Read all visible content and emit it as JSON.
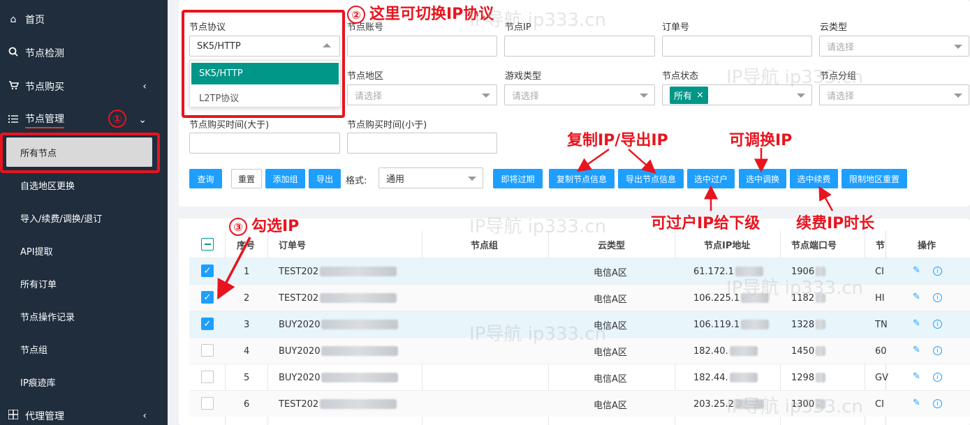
{
  "sidebar": {
    "items": [
      {
        "label": "首页",
        "icon": "home-icon"
      },
      {
        "label": "节点检测",
        "icon": "search-icon"
      },
      {
        "label": "节点购买",
        "icon": "cart-icon"
      },
      {
        "label": "节点管理",
        "icon": "list-icon"
      },
      {
        "label": "代理管理",
        "icon": "grid-icon"
      }
    ],
    "sub_items": [
      "所有节点",
      "自选地区更换",
      "导入/续费/调换/退订",
      "API提取",
      "所有订单",
      "节点操作记录",
      "节点组",
      "IP痕迹库"
    ]
  },
  "filters": {
    "protocol_label": "节点协议",
    "protocol_value": "SK5/HTTP",
    "protocol_options": [
      "SK5/HTTP",
      "L2TP协议"
    ],
    "account_label": "节点账号",
    "ip_label": "节点IP",
    "order_label": "订单号",
    "cloud_label": "云类型",
    "cloud_placeholder": "请选择",
    "region_label": "节点地区",
    "region_placeholder": "请选择",
    "game_label": "游戏类型",
    "game_placeholder": "请选择",
    "status_label": "节点状态",
    "status_tag": "所有",
    "group_label": "节点分组",
    "group_placeholder": "请选择",
    "buy_after_label": "节点购买时间(大于)",
    "buy_before_label": "节点购买时间(小于)",
    "format_label": "格式:",
    "format_value": "通用"
  },
  "buttons": {
    "query": "查询",
    "reset": "重置",
    "add_group": "添加组",
    "export": "导出",
    "expiring": "即将过期",
    "copy_info": "复制节点信息",
    "export_info": "导出节点信息",
    "transfer": "选中过户",
    "swap": "选中调换",
    "renew": "选中续费",
    "reset_region": "限制地区重置"
  },
  "annotations": {
    "circle1": "①",
    "circle2": "②",
    "anno2": "这里可切换IP协议",
    "circle3": "③",
    "anno3": "勾选IP",
    "copy_export": "复制IP/导出IP",
    "swap": "可调换IP",
    "transfer": "可过户IP给下级",
    "renew": "续费IP时长"
  },
  "watermark": "IP导航  ip333.cn",
  "table": {
    "headers": [
      "序号",
      "订单号",
      "节点组",
      "云类型",
      "节点IP地址",
      "节点端口号",
      "节",
      "操作"
    ],
    "rows": [
      {
        "no": "1",
        "order": "TEST202",
        "cloud": "电信A区",
        "ip": "61.172.1",
        "port": "1906",
        "extra": "CI",
        "checked": true
      },
      {
        "no": "2",
        "order": "TEST202",
        "cloud": "电信A区",
        "ip": "106.225.1",
        "port": "1182",
        "extra": "HI",
        "checked": true
      },
      {
        "no": "3",
        "order": "BUY2020",
        "cloud": "电信A区",
        "ip": "106.119.1",
        "port": "1328",
        "extra": "TN",
        "checked": true
      },
      {
        "no": "4",
        "order": "BUY2020",
        "cloud": "电信A区",
        "ip": "182.40.",
        "port": "1450",
        "extra": "60",
        "checked": false
      },
      {
        "no": "5",
        "order": "BUY2020",
        "cloud": "电信A区",
        "ip": "182.44.",
        "port": "1298",
        "extra": "GV",
        "checked": false
      },
      {
        "no": "6",
        "order": "TEST202",
        "cloud": "电信A区",
        "ip": "203.25.2",
        "port": "1300",
        "extra": "CI",
        "checked": false
      }
    ]
  },
  "colors": {
    "sidebar_bg": "#1f2d3d",
    "primary": "#1e9fff",
    "teal": "#009688",
    "annotation_red": "#e8141e",
    "row_highlight": "#e8f5fb"
  }
}
